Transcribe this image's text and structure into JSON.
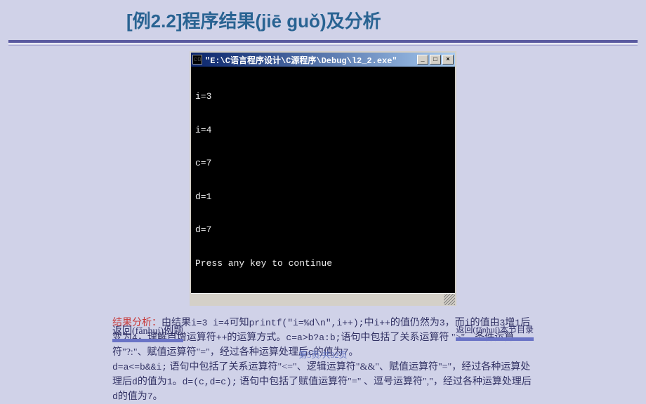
{
  "header": {
    "title_prefix": "[例2.2]程序结果",
    "title_pinyin": "(jiē guǒ)",
    "title_suffix": "及分析"
  },
  "console": {
    "path": "\"E:\\C语言程序设计\\C源程序\\Debug\\l2_2.exe\"",
    "lines": [
      "i=3",
      "i=4",
      "c=7",
      "d=1",
      "d=7",
      "Press any key to continue"
    ],
    "btn_min": "_",
    "btn_max": "□",
    "btn_close": "×",
    "icon": "cū"
  },
  "analysis": {
    "label": "结果分析：",
    "l1a": "由结果",
    "l1b": "i=3 i=4",
    "l1c": "可知",
    "l1d": "printf(\"i=%d\\n\",i++);",
    "l1e": "中",
    "l1f": "i++",
    "l1g": "的值仍然为",
    "l1h": "3",
    "l1i": "，而",
    "l1j": "i",
    "l1k": "的值由",
    "l1l": "3",
    "l1m": "增",
    "l1n": "1",
    "l1o": "后变为",
    "l1p": "4",
    "l1q": "，理解自增运算符",
    "l1r": "++",
    "l1s": "的运算方式。",
    "l2a": "c=a>b?a:b;",
    "l2b": "语句中包括了关系运算符 \">\"、条件运算符\"?:\"、赋值运算符\"=\"，经过各种运算处理后",
    "l2c": "c",
    "l2d": "的值为",
    "l2e": "7",
    "l2f": "。",
    "l3a": "d=a<=b&&i;",
    "l3b": " 语句中包括了关系运算符\"<=\"、逻辑运算符\"&&\"、赋值运算符\"=\"，经过各种运算处理后",
    "l3c": "d",
    "l3d": "的值为",
    "l3e": "1",
    "l3f": "。",
    "l4a": "d=(c,d=c);",
    "l4b": " 语句中包括了赋值运算符\"=\" 、逗号运算符\",\"，经过各种运算处理后",
    "l4c": "d",
    "l4d": "的值为",
    "l4e": "7",
    "l4f": "。"
  },
  "links": {
    "back_example_pre": "返回",
    "back_example_pinyin": "(fǎnhuí)",
    "back_example_post": "例题",
    "back_toc_pre": "返回",
    "back_toc_pinyin": "(fǎnhuí)",
    "back_toc_post": "本节目录"
  },
  "pager": "第5页/共32页"
}
